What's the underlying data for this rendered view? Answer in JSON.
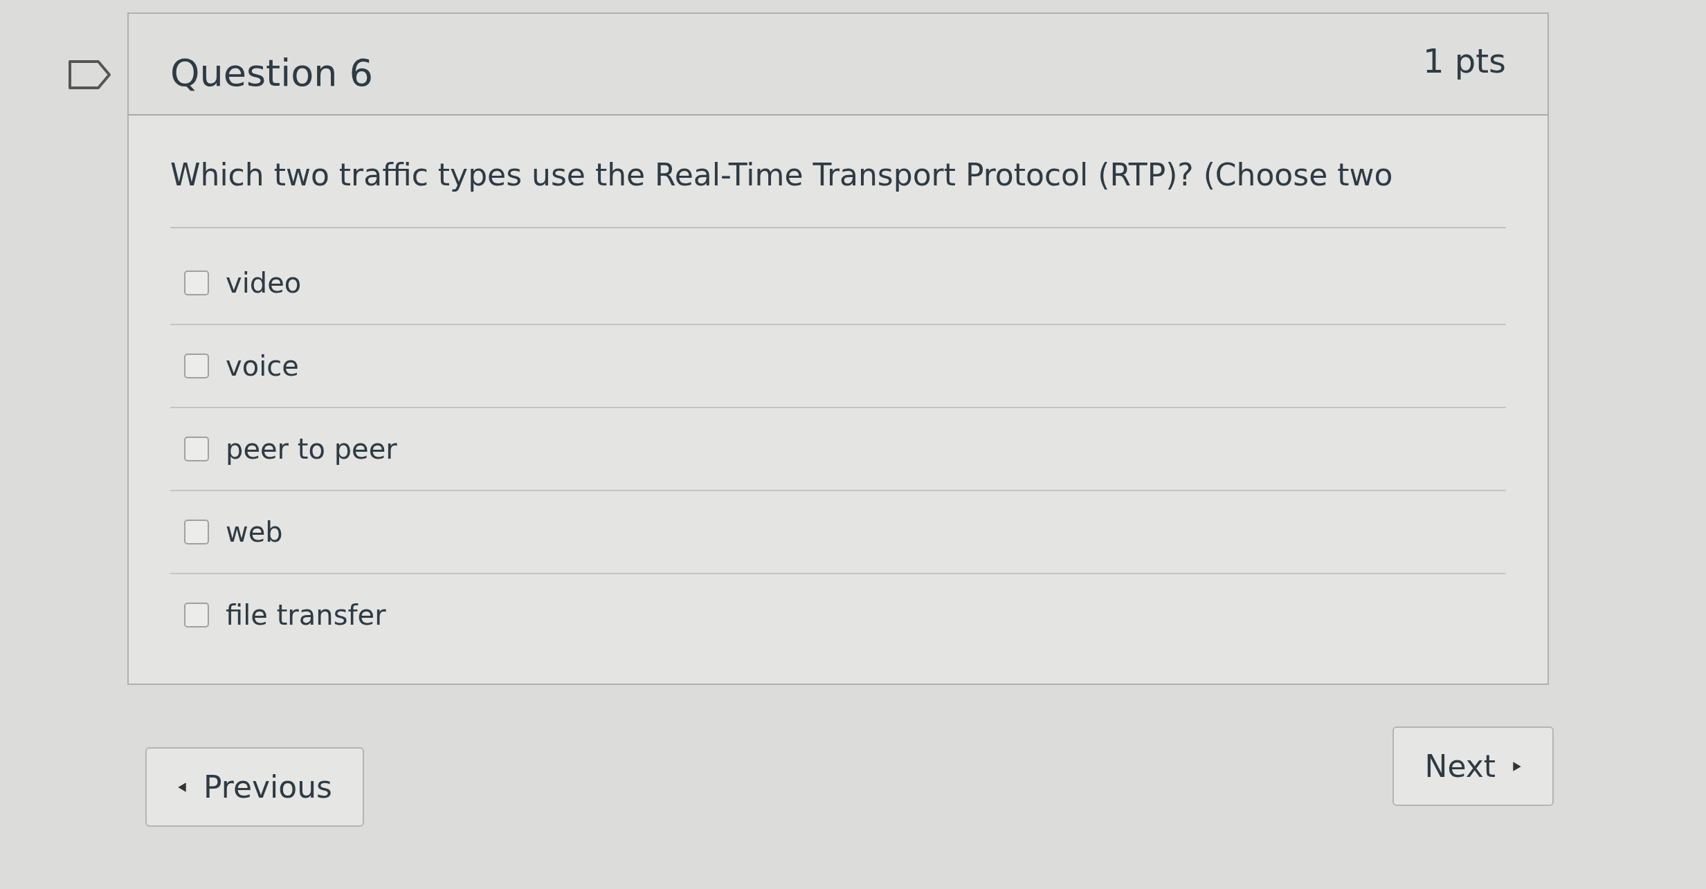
{
  "question": {
    "title": "Question 6",
    "points": "1 pts",
    "text": "Which two traffic types use the Real-Time Transport Protocol (RTP)? (Choose two",
    "answers": [
      {
        "label": "video",
        "checked": false
      },
      {
        "label": "voice",
        "checked": false
      },
      {
        "label": "peer to peer",
        "checked": false
      },
      {
        "label": "web",
        "checked": false
      },
      {
        "label": "file transfer",
        "checked": false
      }
    ]
  },
  "navigation": {
    "previous": "Previous",
    "next": "Next"
  }
}
